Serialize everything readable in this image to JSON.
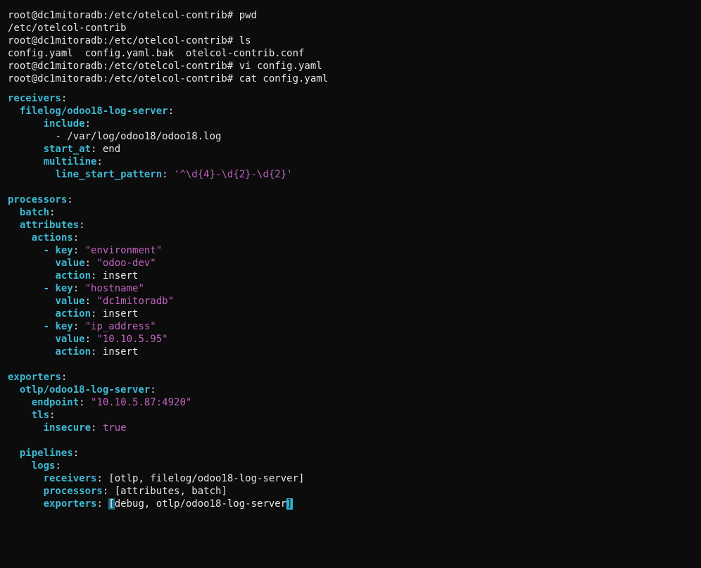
{
  "terminal": {
    "shell_lines": [
      "root@dc1mitoradb:/etc/otelcol-contrib# pwd",
      "/etc/otelcol-contrib",
      "root@dc1mitoradb:/etc/otelcol-contrib# ls",
      "config.yaml  config.yaml.bak  otelcol-contrib.conf",
      "root@dc1mitoradb:/etc/otelcol-contrib# vi config.yaml",
      "root@dc1mitoradb:/etc/otelcol-contrib# cat config.yaml"
    ],
    "yaml": {
      "receivers_key": "receivers",
      "filelog_key": "filelog/odoo18-log-server",
      "include_key": "include",
      "include_item": "- /var/log/odoo18/odoo18.log",
      "start_at_key": "start_at",
      "start_at_val": "end",
      "multiline_key": "multiline",
      "line_start_pattern_key": "line_start_pattern",
      "line_start_pattern_val": "'^\\d{4}-\\d{2}-\\d{2}'",
      "processors_key": "processors",
      "batch_key": "batch",
      "attributes_key": "attributes",
      "actions_key": "actions",
      "actions": [
        {
          "key": "\"environment\"",
          "value": "\"odoo-dev\"",
          "action": "insert"
        },
        {
          "key": "\"hostname\"",
          "value": "\"dc1mitoradb\"",
          "action": "insert"
        },
        {
          "key": "\"ip_address\"",
          "value": "\"10.10.5.95\"",
          "action": "insert"
        }
      ],
      "key_label": "key",
      "value_label": "value",
      "action_label": "action",
      "exporters_key": "exporters",
      "otlp_key": "otlp/odoo18-log-server",
      "endpoint_key": "endpoint",
      "endpoint_val": "\"10.10.5.87:4920\"",
      "tls_key": "tls",
      "insecure_key": "insecure",
      "insecure_val": "true",
      "pipelines_key": "pipelines",
      "logs_key": "logs",
      "receivers_list_key": "receivers",
      "receivers_list_val": "[otlp, filelog/odoo18-log-server]",
      "processors_list_key": "processors",
      "processors_list_val": "[attributes, batch]",
      "exporters_list_key": "exporters",
      "exporters_open": "[",
      "exporters_inner": "debug, otlp/odoo18-log-server",
      "exporters_close": "]"
    }
  },
  "colors": {
    "background": "#0c0c0c",
    "text": "#e6e6e6",
    "key": "#3fb8d3",
    "string": "#c064c0",
    "cursor": "#26b6d6"
  }
}
